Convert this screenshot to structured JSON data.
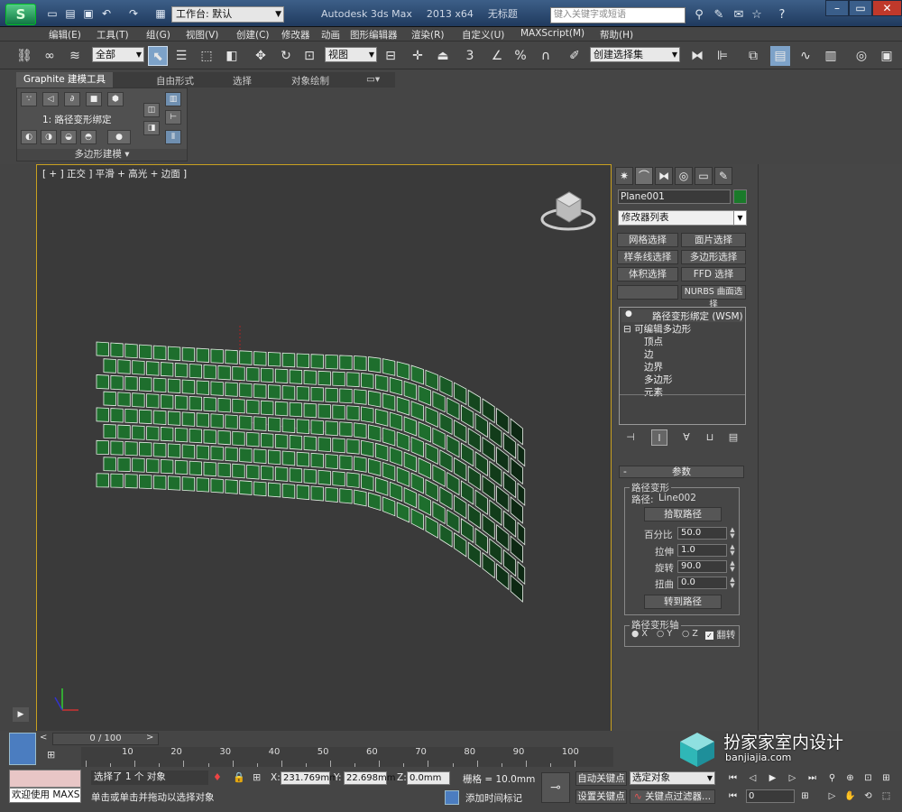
{
  "titlebar": {
    "app_name": "Autodesk 3ds Max",
    "version": "2013 x64",
    "doc": "无标题",
    "workspace_label": "工作台: 默认",
    "search_placeholder": "键入关键字或短语",
    "app_icon": "3ds-max-logo-icon"
  },
  "menu": [
    "编辑(E)",
    "工具(T)",
    "组(G)",
    "视图(V)",
    "创建(C)",
    "修改器",
    "动画",
    "图形编辑器",
    "渲染(R)",
    "自定义(U)",
    "MAXScript(M)",
    "帮助(H)"
  ],
  "toolbar": {
    "selection_filter": "全部",
    "ref_coord": "视图",
    "named_selection": "创建选择集",
    "snap_label": "3",
    "percent_label": "%"
  },
  "ribbon": {
    "tabs": [
      "Graphite 建模工具",
      "自由形式",
      "选择",
      "对象绘制"
    ],
    "panel_label": "1: 路径变形绑定",
    "panel_footer": "多边形建模"
  },
  "viewport": {
    "label": "[ + ] 正交 ] 平滑 + 高光 + 边面 ]"
  },
  "command_panel": {
    "object_name": "Plane001",
    "object_color": "#1a7a2a",
    "modifier_list": "修改器列表",
    "mod_buttons": [
      [
        "网格选择",
        "面片选择"
      ],
      [
        "样条线选择",
        "多边形选择"
      ],
      [
        "体积选择",
        "FFD 选择"
      ],
      [
        "",
        "NURBS 曲面选择"
      ]
    ],
    "stack": {
      "top": "路径变形绑定 (WSM)",
      "base": "可编辑多边形",
      "subs": [
        "顶点",
        "边",
        "边界",
        "多边形",
        "元素"
      ]
    },
    "params": {
      "rollout_title": "参数",
      "group1": "路径变形",
      "path_label": "路径:",
      "path_value": "Line002",
      "pick_btn": "拾取路径",
      "percent_label": "百分比",
      "percent": "50.0",
      "stretch_label": "拉伸",
      "stretch": "1.0",
      "rotate_label": "旋转",
      "rotate": "90.0",
      "twist_label": "扭曲",
      "twist": "0.0",
      "goto_btn": "转到路径",
      "group2": "路径变形轴",
      "axes": [
        "X",
        "Y",
        "Z"
      ],
      "flip_label": "翻转"
    }
  },
  "timeline": {
    "slider": "0 / 100",
    "ticks": [
      "10",
      "20",
      "30",
      "40",
      "50",
      "60",
      "70",
      "80",
      "90",
      "100"
    ]
  },
  "status": {
    "welcome": "欢迎使用 MAXSc",
    "selected": "选择了 1 个 对象",
    "prompt": "单击或单击并拖动以选择对象",
    "x_label": "X:",
    "x": "231.769mm",
    "y_label": "Y:",
    "y": "22.698mm",
    "z_label": "Z:",
    "z": "0.0mm",
    "grid": "栅格 = 10.0mm",
    "add_time_tag": "添加时间标记",
    "auto_key": "自动关键点",
    "set_key": "设置关键点",
    "key_mode": "选定对象",
    "key_filters": "关键点过滤器...",
    "frame": "0"
  },
  "watermark": {
    "text": "扮家家室内设计",
    "sub": "banjiajia.com"
  }
}
